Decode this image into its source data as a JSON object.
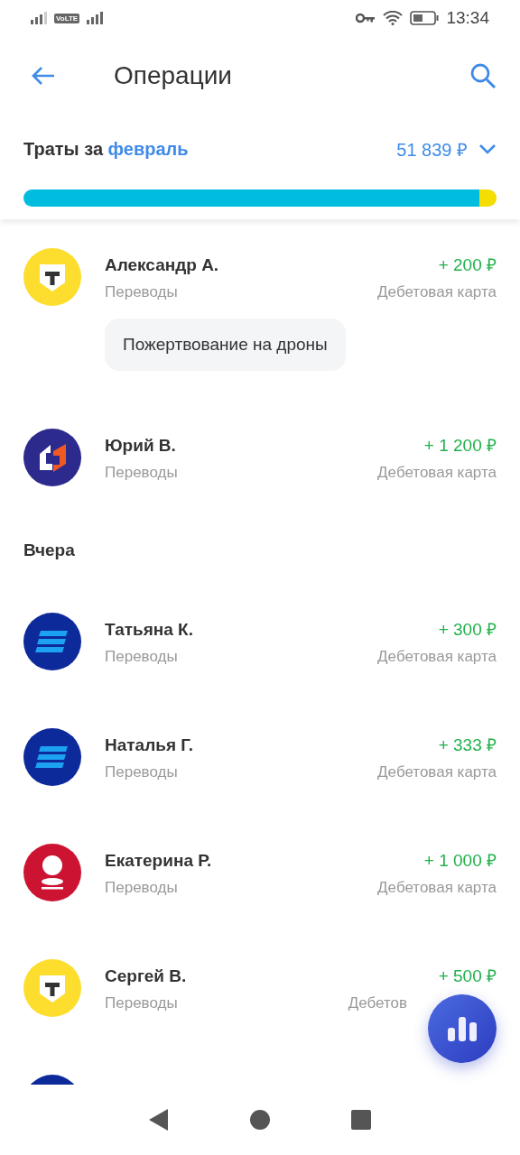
{
  "status_bar": {
    "time": "13:34",
    "volte": "VoLTE"
  },
  "header": {
    "title": "Операции"
  },
  "spending": {
    "label": "Траты за **февраль**",
    "total": "51 839 ₽",
    "expanded": false,
    "segments": [
      {
        "level": 0.964,
        "color": "#00bde0"
      },
      {
        "level": 0.036,
        "color": "#f5dd00"
      }
    ]
  },
  "groups": [
    {
      "rows": [
        {
          "kind": "shield",
          "name": "Александр А.",
          "category": "Переводы",
          "amount": "+ 200 ₽",
          "account": "Дебетовая карта",
          "comment": "Пожертвование на дроны"
        },
        {
          "kind": "split",
          "name": "Юрий В.",
          "category": "Переводы",
          "amount": "+ 1 200 ₽",
          "account": "Дебетовая карта"
        }
      ]
    },
    {
      "title": "Вчера",
      "rows": [
        {
          "kind": "stripes",
          "name": "Татьяна К.",
          "category": "Переводы",
          "amount": "+ 300 ₽",
          "account": "Дебетовая карта"
        },
        {
          "kind": "stripes",
          "name": "Наталья Г.",
          "category": "Переводы",
          "amount": "+ 333 ₽",
          "account": "Дебетовая карта"
        },
        {
          "kind": "person",
          "name": "Екатерина Р.",
          "category": "Переводы",
          "amount": "+ 1 000 ₽",
          "account": "Дебетовая карта"
        },
        {
          "kind": "shield",
          "name": "Сергей В.",
          "category": "Переводы",
          "amount": "+ 500 ₽",
          "account": "Дебетов"
        },
        {
          "kind": "stripes"
        }
      ]
    }
  ]
}
